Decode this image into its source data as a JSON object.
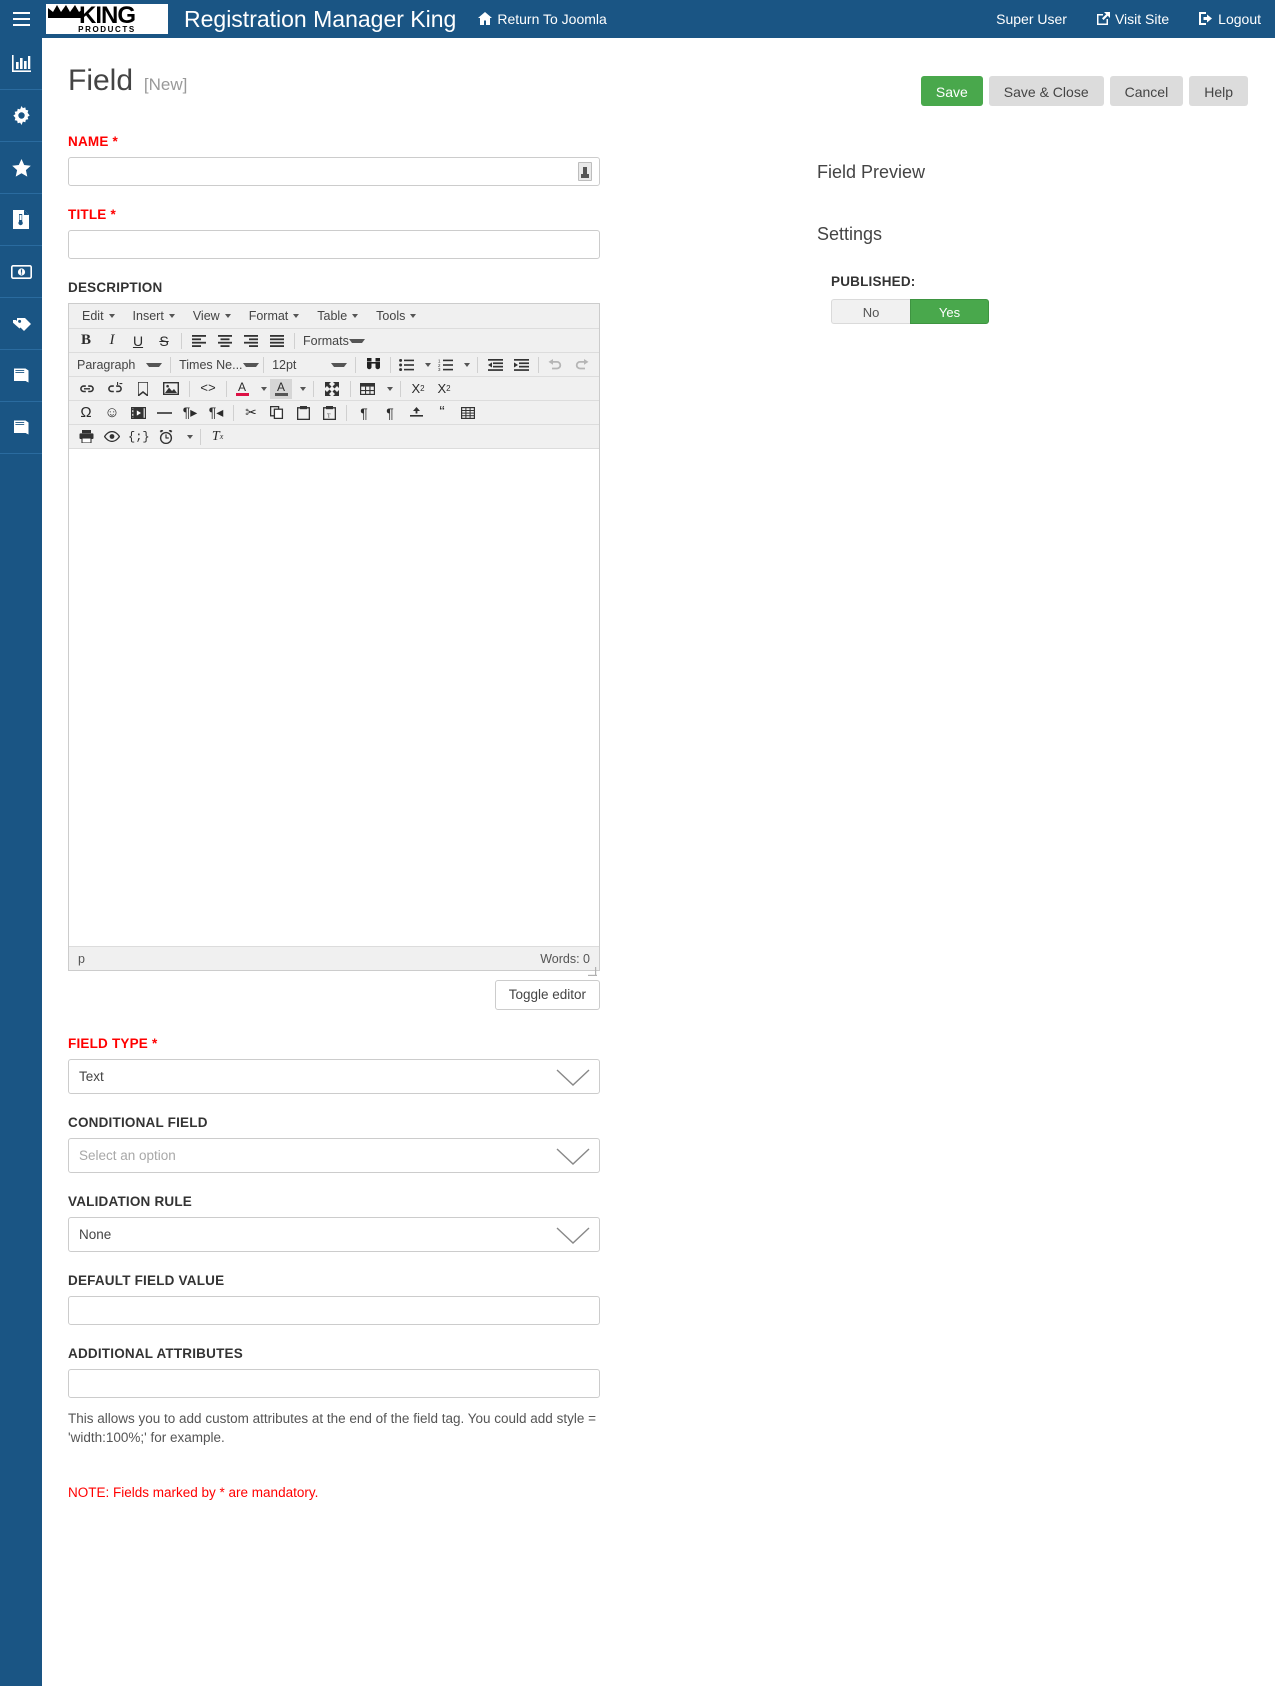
{
  "topbar": {
    "hamburger_icon": "hamburger-icon",
    "logo_main": "KING",
    "logo_sub": "PRODUCTS",
    "app_title": "Registration Manager King",
    "return_label": "Return To Joomla",
    "return_icon": "home-icon",
    "user_label": "Super User",
    "visit_site_label": "Visit Site",
    "visit_site_icon": "external-link-icon",
    "logout_label": "Logout",
    "logout_icon": "logout-icon",
    "bg_color": "#1a5584"
  },
  "sidebar": {
    "items": [
      {
        "icon": "chart-bar-icon",
        "name": "sidebar-item-dashboard"
      },
      {
        "icon": "gear-icon",
        "name": "sidebar-item-settings"
      },
      {
        "icon": "star-icon",
        "name": "sidebar-item-featured"
      },
      {
        "icon": "document-icon",
        "name": "sidebar-item-documents"
      },
      {
        "icon": "money-icon",
        "name": "sidebar-item-payments"
      },
      {
        "icon": "tag-icon",
        "name": "sidebar-item-tags"
      },
      {
        "icon": "book-icon",
        "name": "sidebar-item-book-one"
      },
      {
        "icon": "book-icon",
        "name": "sidebar-item-book-two"
      }
    ]
  },
  "page": {
    "title": "Field",
    "subtitle": "[New]"
  },
  "toolbar": {
    "save_label": "Save",
    "save_close_label": "Save & Close",
    "cancel_label": "Cancel",
    "help_label": "Help",
    "save_color": "#49a84c"
  },
  "form": {
    "name": {
      "label": "NAME",
      "required": "*",
      "value": "",
      "placeholder": ""
    },
    "title": {
      "label": "TITLE",
      "required": "*",
      "value": "",
      "placeholder": ""
    },
    "description": {
      "label": "DESCRIPTION"
    },
    "field_type": {
      "label": "FIELD TYPE",
      "required": "*",
      "value": "Text"
    },
    "conditional_field": {
      "label": "CONDITIONAL FIELD",
      "value": "Select an option"
    },
    "validation_rule": {
      "label": "VALIDATION RULE",
      "value": "None"
    },
    "default_field_value": {
      "label": "DEFAULT FIELD VALUE",
      "value": "",
      "placeholder": ""
    },
    "additional_attributes": {
      "label": "ADDITIONAL ATTRIBUTES",
      "value": "",
      "placeholder": "",
      "help": "This allows you to add custom attributes at the end of the field tag. You could add style = 'width:100%;' for example."
    },
    "mandatory_note": "NOTE: Fields marked by * are mandatory."
  },
  "editor": {
    "menubar": [
      "Edit",
      "Insert",
      "View",
      "Format",
      "Table",
      "Tools"
    ],
    "row_formats_label": "Formats",
    "paragraph_select": "Paragraph",
    "font_select": "Times Ne...",
    "size_select": "12pt",
    "toggle_editor_label": "Toggle editor",
    "status_path": "p",
    "status_words_label": "Words:",
    "status_words_count": "0",
    "row2_icons": [
      "bold-icon",
      "italic-icon",
      "underline-icon",
      "strikethrough-icon",
      "align-left-icon",
      "align-center-icon",
      "align-right-icon",
      "align-justify-icon"
    ],
    "row3_icons": [
      "search-replace-icon",
      "bullet-list-icon",
      "numbered-list-icon",
      "outdent-icon",
      "indent-icon",
      "undo-icon",
      "redo-icon"
    ],
    "row4_icons": [
      "link-icon",
      "unlink-icon",
      "anchor-icon",
      "image-icon",
      "source-code-icon",
      "text-color-icon",
      "background-color-icon",
      "fullscreen-icon",
      "table-icon",
      "subscript-icon",
      "superscript-icon"
    ],
    "row5_icons": [
      "special-character-icon",
      "emoticon-icon",
      "media-icon",
      "horizontal-rule-icon",
      "ltr-icon",
      "rtl-icon",
      "cut-icon",
      "copy-icon",
      "paste-icon",
      "paste-text-icon",
      "show-blocks-icon",
      "visual-blocks-icon",
      "page-break-icon",
      "blockquote-icon",
      "nonbreaking-icon"
    ],
    "row6_icons": [
      "print-icon",
      "preview-icon",
      "template-icon",
      "insert-date-icon",
      "remove-format-icon"
    ]
  },
  "right_panel": {
    "preview_heading": "Field Preview",
    "settings_heading": "Settings",
    "published_label": "PUBLISHED:",
    "published_no": "No",
    "published_yes": "Yes",
    "published_value": "Yes",
    "active_color": "#49a84c"
  }
}
